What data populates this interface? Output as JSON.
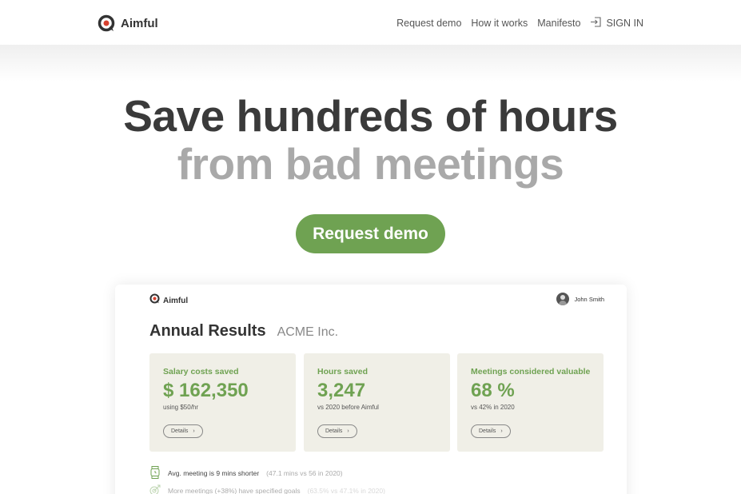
{
  "nav": {
    "brand": "Aimful",
    "links": [
      "Request demo",
      "How it works",
      "Manifesto"
    ],
    "signin": "SIGN IN"
  },
  "hero": {
    "line1": "Save hundreds of hours",
    "line2": "from bad meetings",
    "cta": "Request demo"
  },
  "dashboard": {
    "brand": "Aimful",
    "user": "John Smith",
    "title": "Annual Results",
    "company": "ACME Inc.",
    "stats": [
      {
        "label": "Salary costs saved",
        "value": "$ 162,350",
        "sub": "using $50/hr",
        "details": "Details"
      },
      {
        "label": "Hours saved",
        "value": "3,247",
        "sub": "vs 2020 before Aimful",
        "details": "Details"
      },
      {
        "label": "Meetings considered valuable",
        "value": "68 %",
        "sub": "vs 42% in 2020",
        "details": "Details"
      }
    ],
    "insights": [
      {
        "text": "Avg. meeting is 9 mins shorter",
        "muted": "(47.1 mins vs 56 in 2020)"
      },
      {
        "text": "More meetings (+38%) have specified goals",
        "muted": "(63.5% vs 47.1% in 2020)"
      }
    ]
  },
  "colors": {
    "accent": "#6fa252",
    "brand_red": "#d8412f",
    "card_bg": "#f0efe7"
  }
}
